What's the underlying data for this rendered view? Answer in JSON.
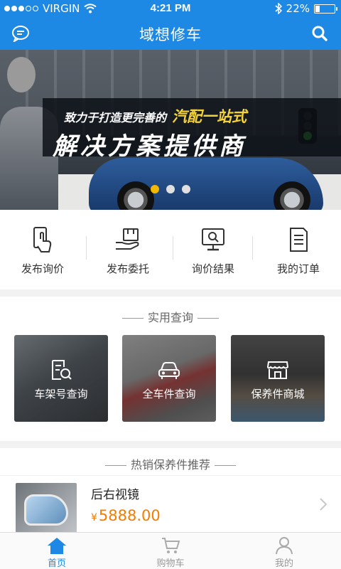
{
  "status_bar": {
    "carrier": "VIRGIN",
    "time": "4:21 PM",
    "battery": "22%",
    "battery_level": 0.22
  },
  "header": {
    "title": "域想修车",
    "left_icon": "chat-icon",
    "right_icon": "search-icon"
  },
  "banner": {
    "slogan_top": "致力于打造更完善的",
    "slogan_accent": "汽配一站式",
    "slogan_main": "解决方案提供商",
    "page_count": 3,
    "active_page": 1
  },
  "quick_actions": [
    {
      "label": "发布询价",
      "icon": "phone-touch-icon"
    },
    {
      "label": "发布委托",
      "icon": "hand-package-icon"
    },
    {
      "label": "询价结果",
      "icon": "monitor-search-icon"
    },
    {
      "label": "我的订单",
      "icon": "document-list-icon"
    }
  ],
  "practical_query": {
    "title": "实用查询",
    "tiles": [
      {
        "label": "车架号查询",
        "icon": "document-search-icon"
      },
      {
        "label": "全车件查询",
        "icon": "car-icon"
      },
      {
        "label": "保养件商城",
        "icon": "store-icon"
      }
    ]
  },
  "hot_sale": {
    "title": "热销保养件推荐",
    "product": {
      "name": "后右视镜",
      "currency": "¥",
      "price": "5888.00"
    }
  },
  "tabbar": [
    {
      "label": "首页",
      "icon": "home-icon",
      "active": true
    },
    {
      "label": "购物车",
      "icon": "cart-icon",
      "active": false
    },
    {
      "label": "我的",
      "icon": "user-icon",
      "active": false
    }
  ],
  "colors": {
    "primary": "#1e88e5",
    "price": "#f57c00",
    "pager_active": "#f4b800"
  }
}
